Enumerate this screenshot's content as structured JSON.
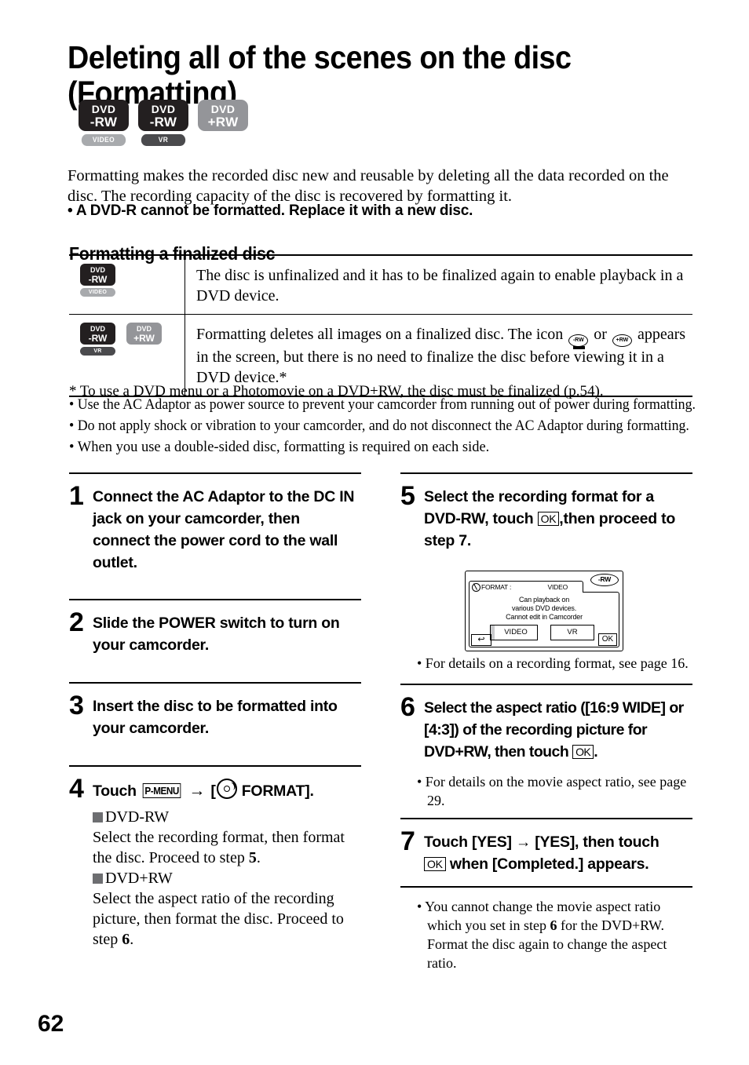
{
  "page": {
    "title": "Deleting all of the scenes on the disc (Formatting)",
    "number": "62"
  },
  "disc_badges": [
    {
      "line1": "DVD",
      "line2": "-RW",
      "style": "dark",
      "pill": "VIDEO",
      "pill_style": "light"
    },
    {
      "line1": "DVD",
      "line2": "-RW",
      "style": "dark",
      "pill": "VR",
      "pill_style": "dark"
    },
    {
      "line1": "DVD",
      "line2": "+RW",
      "style": "gray",
      "pill": "",
      "pill_style": "empty"
    }
  ],
  "intro": {
    "paragraph": "Formatting makes the recorded disc new and reusable by deleting all the data recorded on the disc. The recording capacity of the disc is recovered by formatting it.",
    "bold_note": "• A DVD-R cannot be formatted. Replace it with a new disc."
  },
  "section": {
    "heading": "Formatting a finalized disc",
    "rows": [
      {
        "badges": [
          {
            "line1": "DVD",
            "line2": "-RW",
            "style": "dark",
            "pill": "VIDEO",
            "pill_style": "light"
          }
        ],
        "text": "The disc is unfinalized and it has to be finalized again to enable playback in a DVD device."
      },
      {
        "badges": [
          {
            "line1": "DVD",
            "line2": "-RW",
            "style": "dark",
            "pill": "VR",
            "pill_style": "dark"
          },
          {
            "line1": "DVD",
            "line2": "+RW",
            "style": "gray",
            "pill": "",
            "pill_style": "empty"
          }
        ],
        "text_part1": "Formatting deletes all images on a finalized disc. The icon",
        "icon1": "-RW",
        "text_or": "or",
        "icon2": "+RW",
        "text_part2": "appears in the screen, but there is no need to finalize the disc before viewing it in a DVD device.*"
      }
    ],
    "footnote": "*  To use a DVD menu or a Photomovie on a DVD+RW, the disc must be finalized (p.54).",
    "notes": [
      "• Use the AC Adaptor as power source to prevent your camcorder from running out of power during formatting.",
      "• Do not apply shock or vibration to your camcorder, and do not disconnect the AC Adaptor during formatting.",
      "• When you use a double-sided disc, formatting is required on each side."
    ]
  },
  "steps_left": [
    {
      "num": "1",
      "text": "Connect the AC Adaptor to the DC IN jack on your camcorder, then connect the power cord to the wall outlet."
    },
    {
      "num": "2",
      "text": "Slide the POWER switch to turn on your camcorder."
    },
    {
      "num": "3",
      "text": "Insert the disc to be formatted into your camcorder."
    },
    {
      "num": "4",
      "text_touch": "Touch",
      "chip_pmenu": "P-MENU",
      "arrow": "→",
      "text_format": "[",
      "text_format_label": "FORMAT].",
      "sub": {
        "heading1": "DVD-RW",
        "body1a": "Select the recording format, then format the disc. Proceed to step ",
        "body1b": "5",
        "body1c": ".",
        "heading2": "DVD+RW",
        "body2a": "Select the aspect ratio of the recording picture, then format the disc. Proceed to step ",
        "body2b": "6",
        "body2c": "."
      }
    }
  ],
  "steps_right": [
    {
      "num": "5",
      "text_a": "Select the recording format for a DVD-RW, touch",
      "chip_ok": "OK",
      "text_b": ",then proceed to step 7.",
      "note": "• For details on a recording format, see page 16."
    },
    {
      "num": "6",
      "text_a": "Select the aspect ratio ([16:9 WIDE] or [4:3]) of the recording picture for DVD+RW, then touch",
      "chip_ok": "OK",
      "text_b": ".",
      "note": "• For details on the movie aspect ratio, see page 29."
    },
    {
      "num": "7",
      "text_a": "Touch [YES] → [YES], then touch",
      "chip_ok": "OK",
      "text_b": "when [Completed.] appears."
    }
  ],
  "final_note": {
    "a": "• You cannot change the movie aspect ratio which you set in step ",
    "b": "6",
    "c": " for the DVD+RW. Format the disc again to change the aspect ratio."
  },
  "lcd": {
    "disc_indicator": "-RW",
    "title_icon": "format-disc-icon",
    "title_label": "FORMAT :",
    "title_value": "VIDEO",
    "message_line1": "Can playback on",
    "message_line2": "various DVD devices.",
    "message_line3": "Cannot edit in Camcorder",
    "button_video": "VIDEO",
    "button_vr": "VR",
    "back_icon": "↩",
    "ok_label": "OK"
  }
}
